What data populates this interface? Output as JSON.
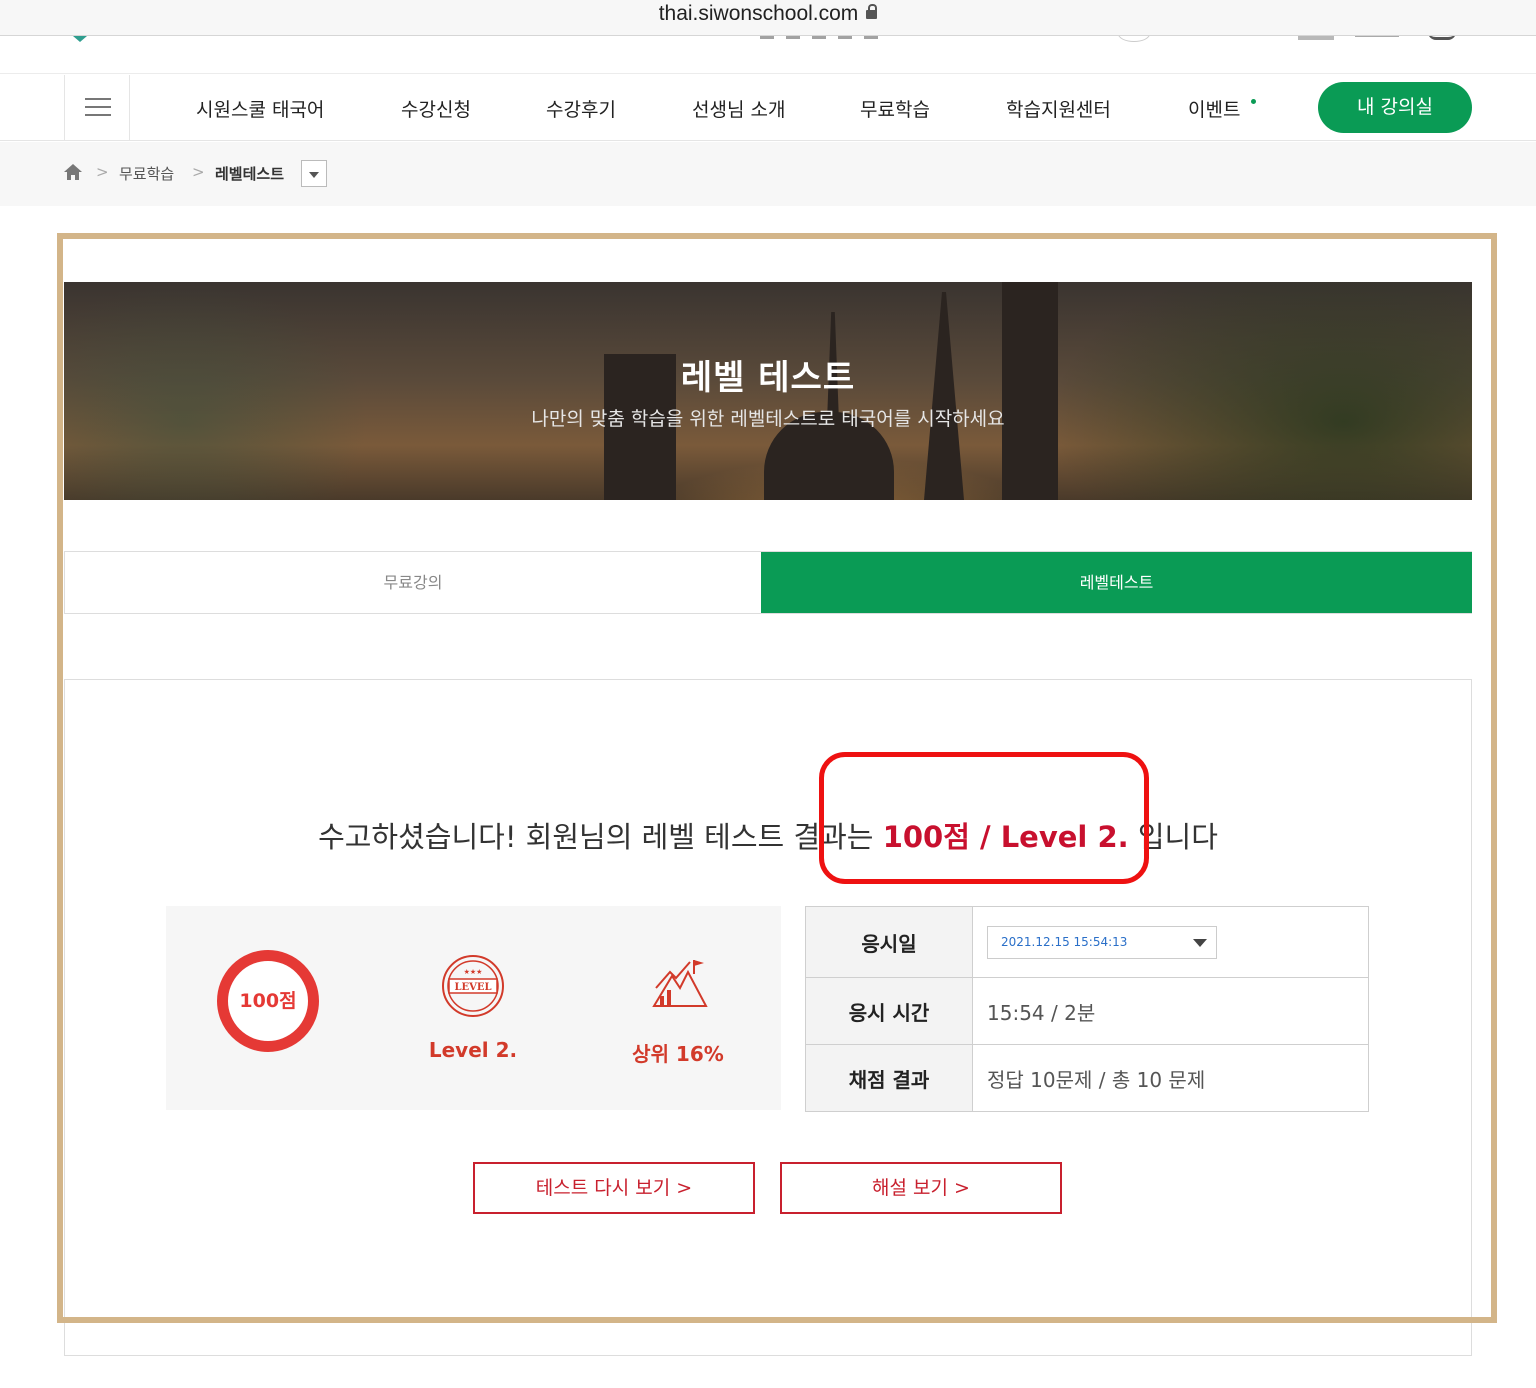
{
  "browser": {
    "url": "thai.siwonschool.com"
  },
  "nav": {
    "items": [
      "시원스쿨 태국어",
      "수강신청",
      "수강후기",
      "선생님 소개",
      "무료학습",
      "학습지원센터",
      "이벤트"
    ],
    "my_classroom": "내 강의실"
  },
  "breadcrumb": {
    "items": [
      "무료학습",
      "레벨테스트"
    ]
  },
  "hero": {
    "title": "레벨 테스트",
    "subtitle": "나만의 맞춤 학습을 위한 레벨테스트로 태국어를 시작하세요"
  },
  "tabs": [
    {
      "label": "무료강의",
      "active": false
    },
    {
      "label": "레벨테스트",
      "active": true
    }
  ],
  "result": {
    "prefix": "수고하셨습니다! 회원님의 레벨 테스트 결과는 ",
    "highlight": "100점 / Level 2.",
    "suffix": " 입니다"
  },
  "summary": {
    "score": "100점",
    "level_icon_text": "LEVEL",
    "level": "Level 2.",
    "rank": "상위 16%"
  },
  "details": {
    "date_label": "응시일",
    "date_value": "2021.12.15 15:54:13",
    "time_label": "응시 시간",
    "time_value": "15:54 / 2분",
    "result_label": "채점 결과",
    "result_value": "정답 10문제 / 총 10 문제"
  },
  "buttons": {
    "retake": "테스트 다시 보기 >",
    "explanation": "해설 보기 >"
  },
  "colors": {
    "brand_green": "#0a9b55",
    "accent_red": "#c8102e",
    "annotation_red": "#ee1111",
    "annotation_frame": "#d3b589"
  }
}
